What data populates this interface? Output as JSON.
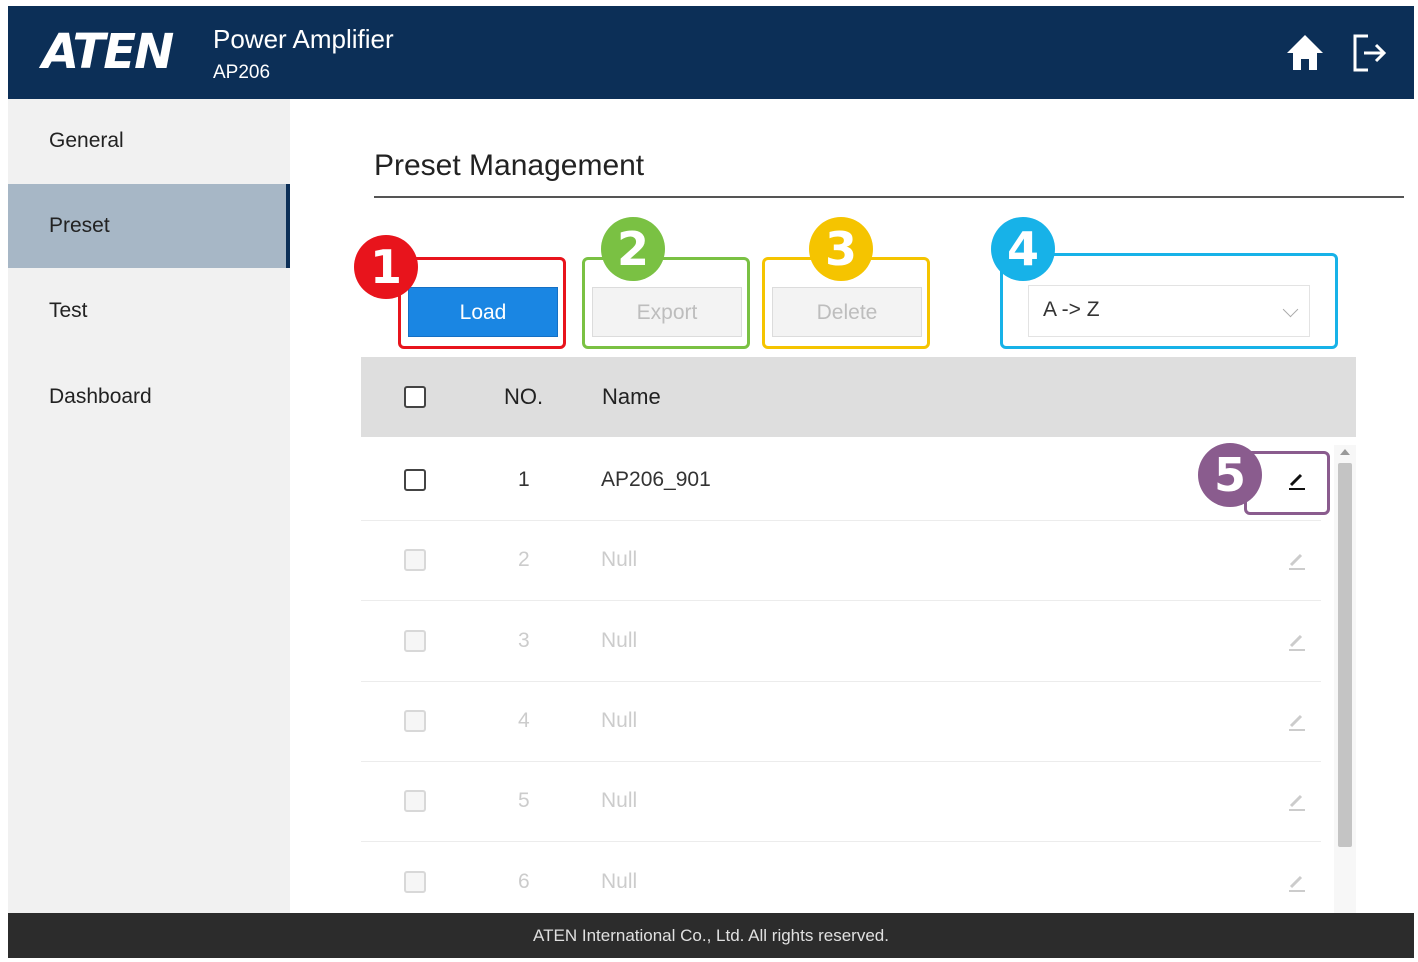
{
  "header": {
    "logo_text": "ATEN",
    "app_title": "Power Amplifier",
    "app_model": "AP206",
    "home_icon": "home-icon",
    "logout_icon": "logout-icon",
    "background_color": "#0c2f57"
  },
  "sidebar": {
    "items": [
      {
        "label": "General",
        "active": false
      },
      {
        "label": "Preset",
        "active": true
      },
      {
        "label": "Test",
        "active": false
      },
      {
        "label": "Dashboard",
        "active": false
      }
    ]
  },
  "main": {
    "title": "Preset Management",
    "buttons": {
      "load": "Load",
      "export": "Export",
      "delete": "Delete"
    },
    "sort": {
      "selected": "A -> Z"
    }
  },
  "annotations": [
    {
      "number": "1",
      "color": "#e8141c"
    },
    {
      "number": "2",
      "color": "#7ac143"
    },
    {
      "number": "3",
      "color": "#f5c400"
    },
    {
      "number": "4",
      "color": "#17b2e8"
    },
    {
      "number": "5",
      "color": "#8a5c8e"
    }
  ],
  "table": {
    "headers": {
      "no": "NO.",
      "name": "Name"
    },
    "rows": [
      {
        "no": "1",
        "name": "AP206_901",
        "enabled": true
      },
      {
        "no": "2",
        "name": "Null",
        "enabled": false
      },
      {
        "no": "3",
        "name": "Null",
        "enabled": false
      },
      {
        "no": "4",
        "name": "Null",
        "enabled": false
      },
      {
        "no": "5",
        "name": "Null",
        "enabled": false
      },
      {
        "no": "6",
        "name": "Null",
        "enabled": false
      }
    ]
  },
  "footer": {
    "text": "ATEN International Co., Ltd. All rights reserved."
  }
}
